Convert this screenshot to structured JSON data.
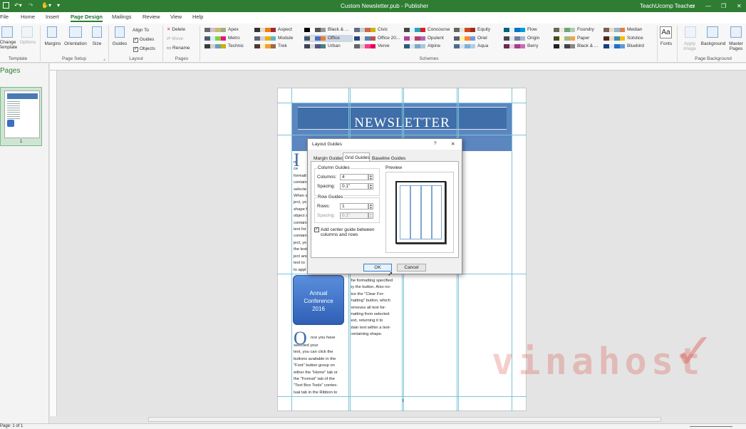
{
  "titlebar": {
    "title": "Custom Newsletter.pub  -  Publisher",
    "user": "TeachUcomp Teacher"
  },
  "tabs": [
    "File",
    "Home",
    "Insert",
    "Page Design",
    "Mailings",
    "Review",
    "View",
    "Help"
  ],
  "ribbon": {
    "template": {
      "change": "Change\nTemplate",
      "options": "Options",
      "label": "Template"
    },
    "page_setup": {
      "margins": "Margins",
      "orientation": "Orientation",
      "size": "Size",
      "label": "Page Setup"
    },
    "layout": {
      "guides": "Guides",
      "align_to": "Align To",
      "guides_check": "Guides",
      "objects_check": "Objects",
      "label": "Layout"
    },
    "pages": {
      "delete": "Delete",
      "move": "Move",
      "rename": "Rename",
      "label": "Pages"
    },
    "schemes_label": "Schemes",
    "schemes": [
      {
        "name": "Apex",
        "colors": [
          "#69676d",
          "#c9c2d1",
          "#ceb966",
          "#9cb084"
        ]
      },
      {
        "name": "Aspect",
        "colors": [
          "#323232",
          "#e3ded1",
          "#f07f09",
          "#9f2936"
        ]
      },
      {
        "name": "Black & ...",
        "colors": [
          "#000000",
          "#ffffff",
          "#555555",
          "#999999"
        ]
      },
      {
        "name": "Civic",
        "colors": [
          "#646b86",
          "#c5d1d7",
          "#d16349",
          "#ccb400"
        ]
      },
      {
        "name": "Concourse",
        "colors": [
          "#464646",
          "#def5fa",
          "#2da2bf",
          "#da1f28"
        ]
      },
      {
        "name": "Equity",
        "colors": [
          "#696464",
          "#e9e5dc",
          "#d34817",
          "#9b2d1f"
        ]
      },
      {
        "name": "Flow",
        "colors": [
          "#04617b",
          "#dbf5f9",
          "#0f6fc6",
          "#009dd9"
        ]
      },
      {
        "name": "Foundry",
        "colors": [
          "#676a55",
          "#eaebde",
          "#72a376",
          "#b0ccb0"
        ]
      },
      {
        "name": "Median",
        "colors": [
          "#775f55",
          "#ebddc3",
          "#94b6d2",
          "#dd8047"
        ]
      },
      {
        "name": "Metro",
        "colors": [
          "#4e5b6f",
          "#d6ecff",
          "#7fd13b",
          "#ea157a"
        ]
      },
      {
        "name": "Module",
        "colors": [
          "#5a6378",
          "#d4d4d4",
          "#f0ad00",
          "#60b5cc"
        ]
      },
      {
        "name": "Office",
        "colors": [
          "#44546a",
          "#e7e6e6",
          "#4472c4",
          "#ed7d31"
        ]
      },
      {
        "name": "Office 20...",
        "colors": [
          "#1f497d",
          "#eeece1",
          "#4f81bd",
          "#c0504d"
        ]
      },
      {
        "name": "Opulent",
        "colors": [
          "#b13f9a",
          "#f4e7ed",
          "#b83d68",
          "#ac66bb"
        ]
      },
      {
        "name": "Oriel",
        "colors": [
          "#575f6d",
          "#fff39d",
          "#fe8637",
          "#7598d9"
        ]
      },
      {
        "name": "Origin",
        "colors": [
          "#464653",
          "#dde9ec",
          "#727ca3",
          "#9fb8cd"
        ]
      },
      {
        "name": "Paper",
        "colors": [
          "#444d26",
          "#fefac9",
          "#a5b592",
          "#f3a447"
        ]
      },
      {
        "name": "Solstice",
        "colors": [
          "#4f271c",
          "#e7dec9",
          "#3891a7",
          "#feb80a"
        ]
      },
      {
        "name": "Technic",
        "colors": [
          "#3b3b3b",
          "#d4d2d0",
          "#6ea0b0",
          "#ccaf0a"
        ]
      },
      {
        "name": "Trek",
        "colors": [
          "#4e3b30",
          "#fbeec9",
          "#f0a22e",
          "#a5644e"
        ]
      },
      {
        "name": "Urban",
        "colors": [
          "#424456",
          "#dedede",
          "#53548a",
          "#438086"
        ]
      },
      {
        "name": "Verve",
        "colors": [
          "#666666",
          "#d2d2d2",
          "#ff388c",
          "#e40059"
        ]
      },
      {
        "name": "Aqua",
        "colors": [
          "#4f6d8a",
          "#d8e4ee",
          "#7fb2d7",
          "#b3cee4"
        ]
      },
      {
        "name": "Berry",
        "colors": [
          "#6d2a55",
          "#e8d2e1",
          "#a6408a",
          "#ca6db2"
        ]
      },
      {
        "name": "Black & ...",
        "colors": [
          "#222222",
          "#eeeeee",
          "#444444",
          "#888888"
        ]
      },
      {
        "name": "Bluebird",
        "colors": [
          "#1b3f7a",
          "#e0ecf7",
          "#2a6cc5",
          "#5c9ad9"
        ]
      },
      {
        "name": "Alpine",
        "colors": [
          "#2e5c7a",
          "#d6e7f0",
          "#7fa9c9",
          "#a8c8de"
        ]
      }
    ],
    "fonts": "Fonts",
    "apply_image": "Apply\nImage",
    "background": "Background",
    "master_pages": "Master\nPages",
    "page_background_label": "Page Background",
    "accent": "#2e7d32"
  },
  "pages_pane": {
    "title": "Pages",
    "page_number": "1"
  },
  "newsletter": {
    "title": "NEWSLETTER",
    "col1_lines": [
      "n",
      "ce",
      "formatt",
      "contain",
      "selecte",
      "When s",
      "ject, yo",
      "shape f",
      "object a",
      "contain",
      "text for",
      "contain",
      "ject, yo",
      "the text",
      "ject and",
      "text to",
      "to appl"
    ],
    "dropcap1": "I",
    "badge": [
      "Annual",
      "Conference",
      "2016"
    ],
    "dropcap2": "O",
    "para2_first": "nce you have",
    "para2": [
      "selected your",
      "text, you can click the",
      "buttons available in the",
      "\"Font\" button group on",
      "either the \"Home\" tab or",
      "the \"Format\" tab of the",
      "\"Text Box Tools\" contex-",
      "tual tab in the Ribbon to"
    ],
    "col2": [
      "the formatting specified",
      "by the button. Also no-",
      "tice the \"Clear For-",
      "matting\" button, which",
      "removes all text for-",
      "matting from selected",
      "text, returning it to",
      "plain text within a text-",
      "containing shape."
    ],
    "page_num": "1"
  },
  "dialog": {
    "title": "Layout Guides",
    "help": "?",
    "close": "✕",
    "tabs": [
      "Margin Guides",
      "Grid Guides",
      "Baseline Guides"
    ],
    "column_guides": "Column Guides",
    "columns_label": "Columns:",
    "columns_value": "4",
    "spacing_label": "Spacing:",
    "spacing_value": "0.1\"",
    "row_guides": "Row Guides",
    "rows_label": "Rows:",
    "rows_value": "1",
    "row_spacing_label": "Spacing:",
    "row_spacing_value": "0.1\"",
    "center_guide": "Add center guide between columns and rows",
    "preview": "Preview",
    "ok": "OK",
    "cancel": "Cancel"
  },
  "status": {
    "page": "Page: 1 of 1"
  },
  "watermark": "vinahost"
}
